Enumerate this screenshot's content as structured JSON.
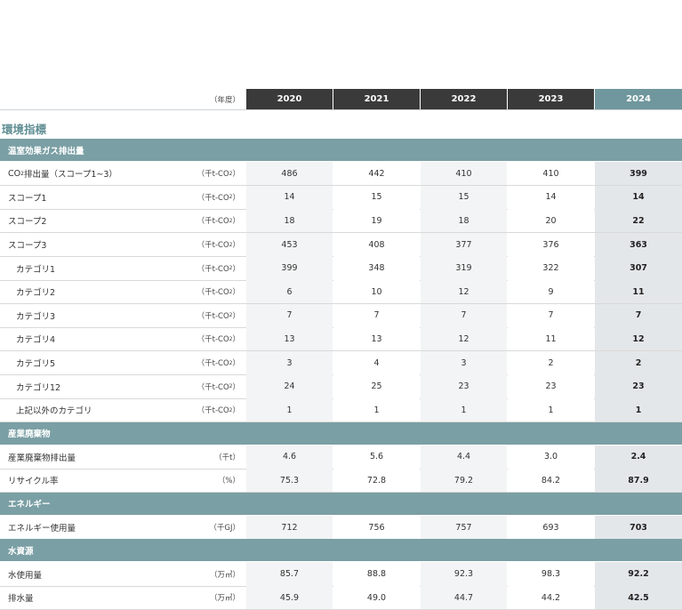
{
  "header": {
    "unit_label": "（年度）",
    "years": [
      "2020",
      "2021",
      "2022",
      "2023",
      "2024"
    ]
  },
  "title": "環境指標",
  "sections": [
    {
      "name": "温室効果ガス排出量",
      "rows": [
        {
          "label": "CO₂排出量（スコープ1~3）",
          "unit": "（千t-CO₂）",
          "values": [
            "486",
            "442",
            "410",
            "410",
            "399"
          ]
        },
        {
          "label": "スコープ1",
          "unit": "（千t-CO₂）",
          "values": [
            "14",
            "15",
            "15",
            "14",
            "14"
          ]
        },
        {
          "label": "スコープ2",
          "unit": "（千t-CO₂）",
          "values": [
            "18",
            "19",
            "18",
            "20",
            "22"
          ]
        },
        {
          "label": "スコープ3",
          "unit": "（千t-CO₂）",
          "values": [
            "453",
            "408",
            "377",
            "376",
            "363"
          ]
        },
        {
          "label": "カテゴリ1",
          "unit": "（千t-CO₂）",
          "values": [
            "399",
            "348",
            "319",
            "322",
            "307"
          ],
          "indent": true
        },
        {
          "label": "カテゴリ2",
          "unit": "（千t-CO₂）",
          "values": [
            "6",
            "10",
            "12",
            "9",
            "11"
          ],
          "indent": true
        },
        {
          "label": "カテゴリ3",
          "unit": "（千t-CO₂）",
          "values": [
            "7",
            "7",
            "7",
            "7",
            "7"
          ],
          "indent": true
        },
        {
          "label": "カテゴリ4",
          "unit": "（千t-CO₂）",
          "values": [
            "13",
            "13",
            "12",
            "11",
            "12"
          ],
          "indent": true
        },
        {
          "label": "カテゴリ5",
          "unit": "（千t-CO₂）",
          "values": [
            "3",
            "4",
            "3",
            "2",
            "2"
          ],
          "indent": true
        },
        {
          "label": "カテゴリ12",
          "unit": "（千t-CO₂）",
          "values": [
            "24",
            "25",
            "23",
            "23",
            "23"
          ],
          "indent": true
        },
        {
          "label": "上記以外のカテゴリ",
          "unit": "（千t-CO₂）",
          "values": [
            "1",
            "1",
            "1",
            "1",
            "1"
          ],
          "indent": true
        }
      ]
    },
    {
      "name": "産業廃棄物",
      "rows": [
        {
          "label": "産業廃棄物排出量",
          "unit": "（千t）",
          "values": [
            "4.6",
            "5.6",
            "4.4",
            "3.0",
            "2.4"
          ]
        },
        {
          "label": "リサイクル率",
          "unit": "（%）",
          "values": [
            "75.3",
            "72.8",
            "79.2",
            "84.2",
            "87.9"
          ]
        }
      ]
    },
    {
      "name": "エネルギー",
      "rows": [
        {
          "label": "エネルギー使用量",
          "unit": "（千GJ）",
          "values": [
            "712",
            "756",
            "757",
            "693",
            "703"
          ]
        }
      ]
    },
    {
      "name": "水資源",
      "rows": [
        {
          "label": "水使用量",
          "unit": "（万㎥）",
          "values": [
            "85.7",
            "88.8",
            "92.3",
            "98.3",
            "92.2"
          ]
        },
        {
          "label": "排水量",
          "unit": "（万㎥）",
          "values": [
            "45.9",
            "49.0",
            "44.7",
            "44.2",
            "42.5"
          ]
        }
      ]
    }
  ],
  "colors": {
    "header_dark": "#3a3a3a",
    "header_accent": "#6f979d",
    "section_bar": "#7a9fa4",
    "title_text": "#5f8e93",
    "cell_light": "#f3f4f5",
    "cell_highlight": "#e4e7ea"
  }
}
